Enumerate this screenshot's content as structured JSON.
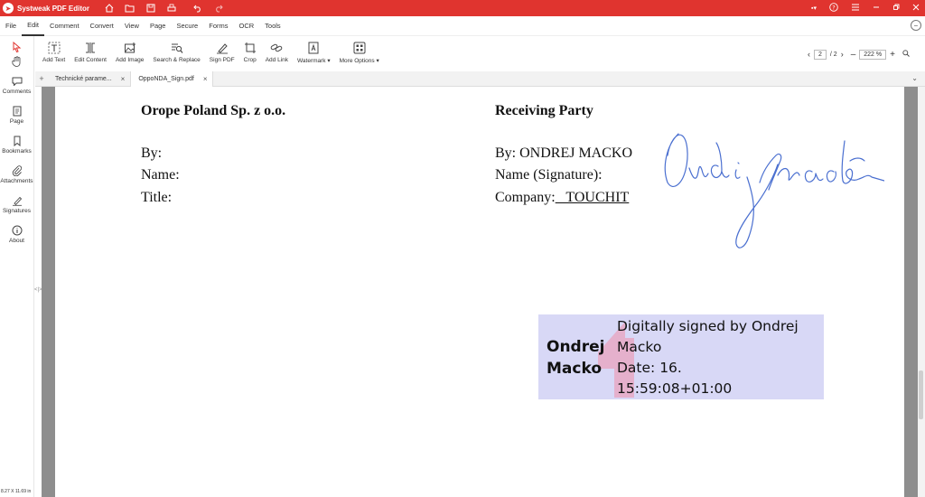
{
  "app": {
    "title": "Systweak PDF Editor",
    "logo_icon": "pdf-editor-logo"
  },
  "colors": {
    "titlebar": "#e0342f",
    "signature_box": "#d8d8f6",
    "signature_ink": "#3b5fc4"
  },
  "menu": {
    "items": [
      "File",
      "Edit",
      "Comment",
      "Convert",
      "View",
      "Page",
      "Secure",
      "Forms",
      "OCR",
      "Tools"
    ],
    "active": "Edit"
  },
  "toolbar": {
    "items": [
      {
        "label": "Add Text",
        "icon": "add-text-icon"
      },
      {
        "label": "Edit Content",
        "icon": "edit-content-icon"
      },
      {
        "label": "Add Image",
        "icon": "add-image-icon"
      },
      {
        "label": "Search & Replace",
        "icon": "search-replace-icon"
      },
      {
        "label": "Sign PDF",
        "icon": "sign-pdf-icon"
      },
      {
        "label": "Crop",
        "icon": "crop-icon"
      },
      {
        "label": "Add Link",
        "icon": "add-link-icon"
      },
      {
        "label": "Watermark ▾",
        "icon": "watermark-icon"
      },
      {
        "label": "More Options ▾",
        "icon": "more-options-icon"
      }
    ]
  },
  "pager": {
    "current": "2",
    "total": "/ 2",
    "zoom": "222 %"
  },
  "sidebar": {
    "items": [
      {
        "label": "Comments",
        "icon": "comment-icon"
      },
      {
        "label": "Page",
        "icon": "page-icon"
      },
      {
        "label": "Bookmarks",
        "icon": "bookmark-icon"
      },
      {
        "label": "Attachments",
        "icon": "attachment-icon"
      },
      {
        "label": "Signatures",
        "icon": "signature-icon"
      },
      {
        "label": "About",
        "icon": "info-icon"
      }
    ]
  },
  "status": {
    "page_size": "8.27 X 11.69 in"
  },
  "tabs": [
    {
      "label": "Technické parame...",
      "active": false
    },
    {
      "label": "OppoNDA_Sign.pdf",
      "active": true
    }
  ],
  "document": {
    "left": {
      "company": "Orope Poland Sp. z o.o.",
      "by": "By:",
      "name": "Name:",
      "title": "Title:"
    },
    "right": {
      "heading": "Receiving Party",
      "by": "By: ONDREJ MACKO",
      "name": "Name (Signature):",
      "company_label": "Company:",
      "company_value": "   TOUCHIT"
    },
    "digital_signature": {
      "name_line1": "Ondrej",
      "name_line2": "Macko",
      "line1": "Digitally signed by Ondrej",
      "line2": "Macko",
      "line3": "Date: 16.",
      "line4": "15:59:08+01:00"
    }
  }
}
